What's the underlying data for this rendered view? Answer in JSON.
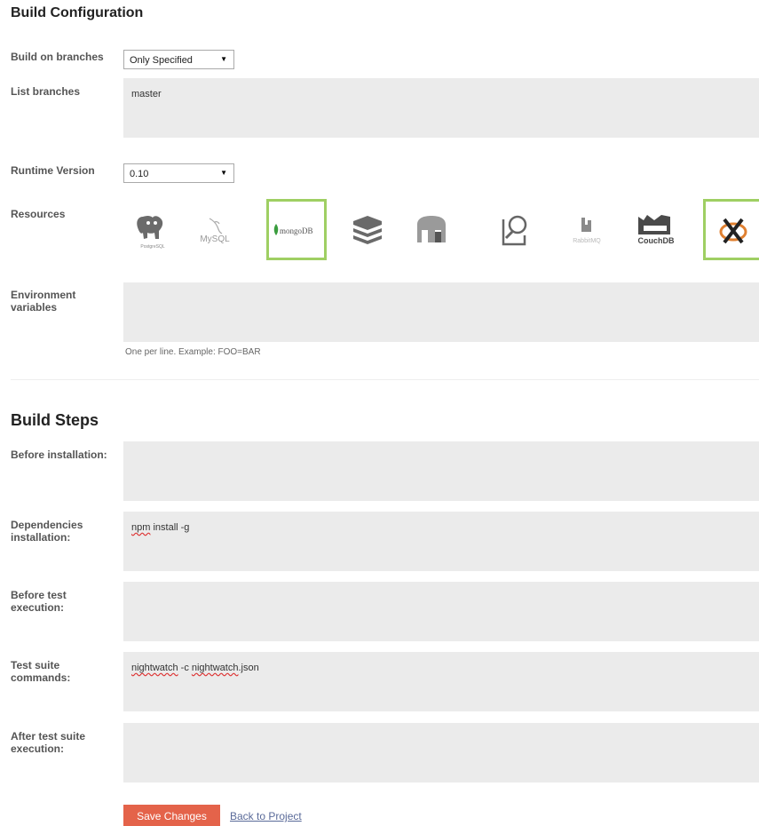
{
  "build_configuration": {
    "title": "Build Configuration",
    "branches_label": "Build on branches",
    "branches_value": "Only Specified",
    "list_branches_label": "List branches",
    "list_branches_value": "master",
    "runtime_label": "Runtime Version",
    "runtime_value": "0.10",
    "resources_label": "Resources",
    "resources": [
      {
        "name": "postgresql",
        "caption": "PostgreSQL",
        "selected": false
      },
      {
        "name": "mysql",
        "caption": "MySQL",
        "selected": false
      },
      {
        "name": "mongodb",
        "caption": "mongoDB",
        "selected": true
      },
      {
        "name": "redis",
        "caption": "",
        "selected": false
      },
      {
        "name": "memcached",
        "caption": "",
        "selected": false
      },
      {
        "name": "elasticsearch",
        "caption": "",
        "selected": false
      },
      {
        "name": "rabbitmq",
        "caption": "RabbitMQ",
        "selected": false
      },
      {
        "name": "couchdb",
        "caption": "CouchDB",
        "selected": false
      },
      {
        "name": "xvfb",
        "caption": "",
        "selected": true
      }
    ],
    "env_label": "Environment variables",
    "env_value": "",
    "env_hint": "One per line. Example: FOO=BAR"
  },
  "build_steps": {
    "title": "Build Steps",
    "before_install_label": "Before installation:",
    "before_install_value": "",
    "deps_label": "Dependencies installation:",
    "deps_value_word1": "npm",
    "deps_value_rest": " install -g",
    "before_test_label": "Before test execution:",
    "before_test_value": "",
    "test_label": "Test suite commands:",
    "test_value_word1": "nightwatch",
    "test_value_mid": " -c ",
    "test_value_word2": "nightwatch",
    "test_value_end": ".json",
    "after_test_label": "After test suite execution:",
    "after_test_value": ""
  },
  "actions": {
    "save_label": "Save Changes",
    "back_label": "Back to Project"
  },
  "colors": {
    "selected_border": "#9fcf63",
    "save_button": "#e4634a",
    "field_background": "#ebebeb"
  }
}
